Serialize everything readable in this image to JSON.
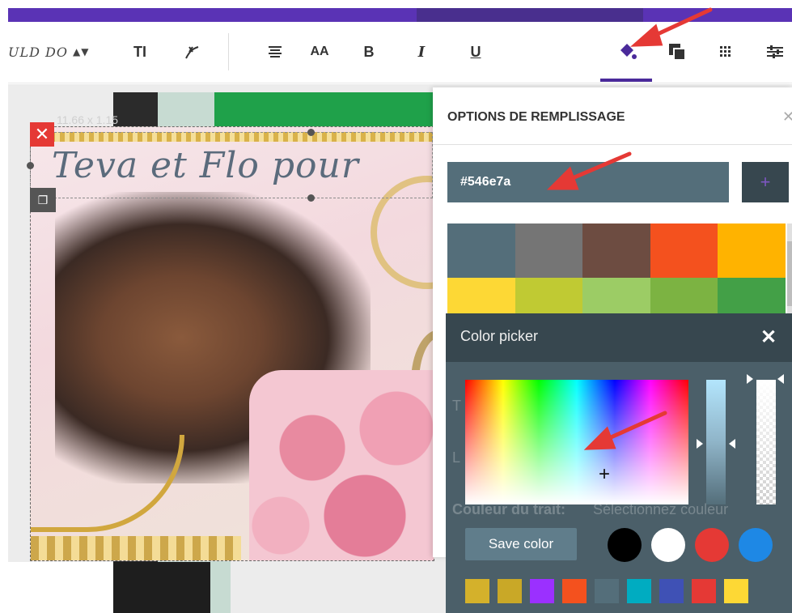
{
  "toolbar": {
    "font_name": "ULD DO",
    "font_arrows": "⬍",
    "text_icon": "TΙ",
    "bold_label": "B",
    "italic_label": "I",
    "underline_label": "U",
    "case_label": "AA"
  },
  "canvas": {
    "dimensions": "11.66 x 1.15",
    "design_text": "Teva et Flo pour"
  },
  "panel": {
    "title": "OPTIONS DE REMPLISSAGE",
    "hex_value": "#546e7a",
    "plus_label": "+",
    "swatches": [
      "#546e7a",
      "#757575",
      "#6d4c41",
      "#f4511e",
      "#ffb300",
      "#fdd835",
      "#c0ca33",
      "#9ccc65",
      "#7cb342",
      "#43a047"
    ]
  },
  "picker": {
    "title": "Color picker",
    "save_label": "Save color",
    "ghost_texts": [
      "Couleur du trait:",
      "Sélectionnez couleur"
    ],
    "preset_circles": [
      "#000000",
      "#ffffff",
      "#e53935",
      "#1e88e5"
    ],
    "preset_squares": [
      "#d4b12b",
      "#c9a827",
      "#9b30ff",
      "#f4511e",
      "#546e7a",
      "#00acc1",
      "#3f51b5",
      "#e53935",
      "#fdd835"
    ]
  },
  "colors": {
    "accent": "#5a33b5",
    "annotation_arrow": "#e53935"
  }
}
